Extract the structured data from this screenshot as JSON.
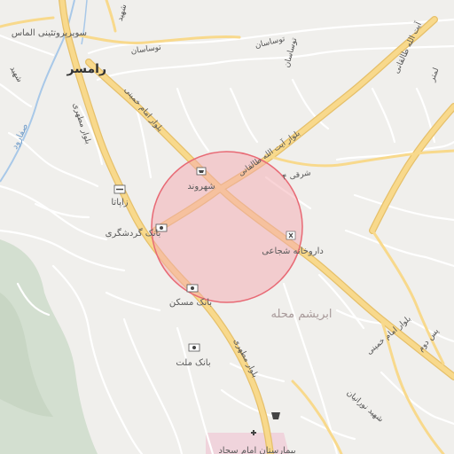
{
  "map": {
    "colors": {
      "background": "#f0efec",
      "minor_road": "#ffffff",
      "major_road": "#f8d98c",
      "major_road_casing": "#e6c06a",
      "river": "#a8c8e8",
      "park": "#d3dfd0",
      "hospital": "#f0d4dc",
      "highlight_fill": "#f4a9b0",
      "highlight_stroke": "#e86a75"
    },
    "labels": {
      "city": "رامسر",
      "supermarket": "سوپرپروتئینی الماس",
      "street_toosasan_1": "توساسان",
      "street_toosasan_2": "توساسان",
      "street_toosasan_3": "توساسان",
      "street_shahid": "شهید",
      "street_shahid_2": "شهید",
      "street_taleghani_ne": "آیت الله طالقانی",
      "street_lamtar": "لمتر",
      "street_safarood": "صفارود",
      "blvd_motahari_n": "بلوار مطهری",
      "blvd_khomeini_n": "بلوار امام خمینی",
      "blvd_taleghani": "بلوار آیت الله طالقانی",
      "shahrvand": "شهروند",
      "zapata": "زاپاتا",
      "sharghi": "شرقی ۴",
      "bank_gardeshgari": "بانک گردشگری",
      "pharmacy": "داروخانه شجاعی",
      "bank_maskan": "بانک مسکن",
      "district": "ابریشم محله",
      "bank_mellat": "بانک ملت",
      "blvd_motahari_s": "بلوار مطهری",
      "blvd_khomeini_s": "بلوار امام خمینی",
      "bus_doom": "پس دوم",
      "street_nooranian": "شهید نورانیان",
      "hospital": "بیمارستان امام سجاد"
    },
    "icons": {
      "shahrvand": "shopping-cart-icon",
      "zapata": "restaurant-icon",
      "bank_gardeshgari": "bank-icon",
      "pharmacy": "pharmacy-icon",
      "bank_maskan": "bank-icon",
      "bank_mellat": "bank-icon",
      "shop_south": "shopping-basket-icon",
      "hospital": "hospital-cross-icon"
    }
  }
}
